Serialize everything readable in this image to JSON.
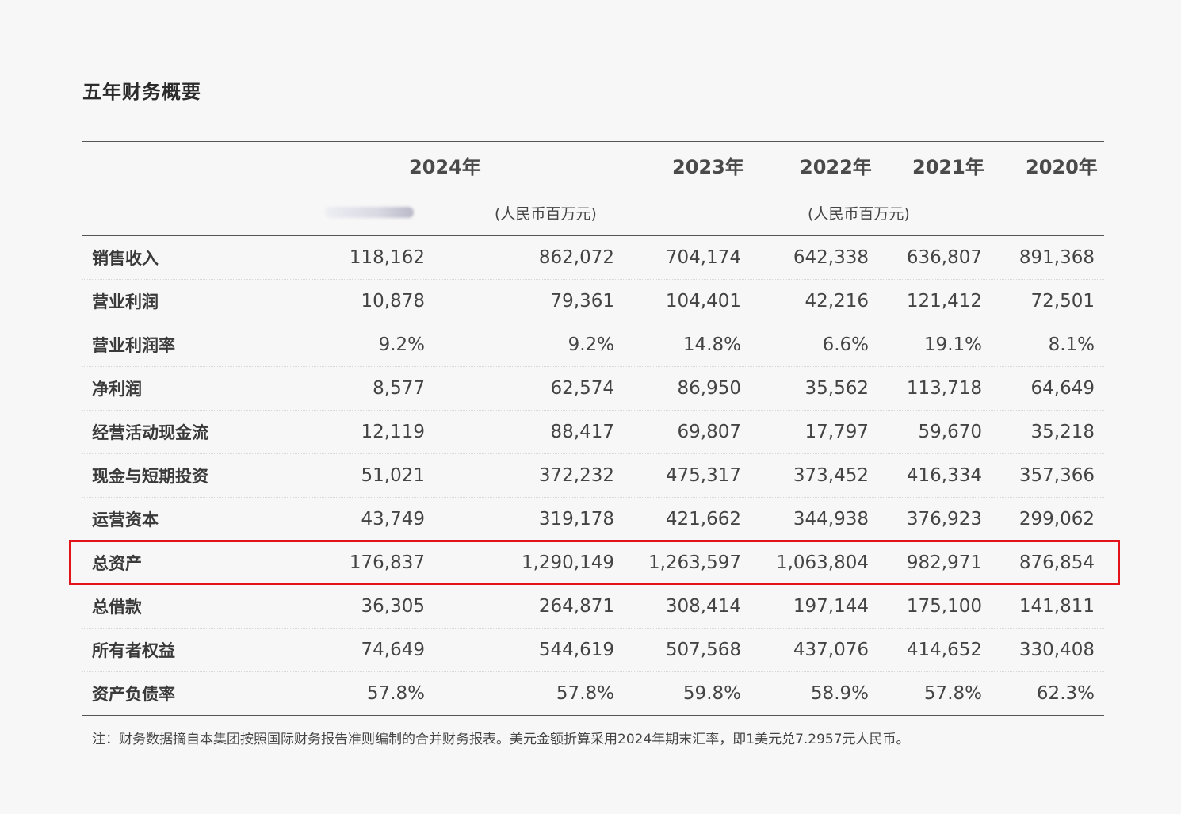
{
  "page_title": "五年财务概要",
  "years": [
    "2024年",
    "2023年",
    "2022年",
    "2021年",
    "2020年"
  ],
  "units": {
    "blurred_label": "",
    "rmb_2024": "(人民币百万元)",
    "rmb_prior": "(人民币百万元)"
  },
  "rows": [
    {
      "label": "销售收入",
      "values": [
        "118,162",
        "862,072",
        "704,174",
        "642,338",
        "636,807",
        "891,368"
      ]
    },
    {
      "label": "营业利润",
      "values": [
        "10,878",
        "79,361",
        "104,401",
        "42,216",
        "121,412",
        "72,501"
      ]
    },
    {
      "label": "营业利润率",
      "values": [
        "9.2%",
        "9.2%",
        "14.8%",
        "6.6%",
        "19.1%",
        "8.1%"
      ]
    },
    {
      "label": "净利润",
      "values": [
        "8,577",
        "62,574",
        "86,950",
        "35,562",
        "113,718",
        "64,649"
      ]
    },
    {
      "label": "经营活动现金流",
      "values": [
        "12,119",
        "88,417",
        "69,807",
        "17,797",
        "59,670",
        "35,218"
      ]
    },
    {
      "label": "现金与短期投资",
      "values": [
        "51,021",
        "372,232",
        "475,317",
        "373,452",
        "416,334",
        "357,366"
      ]
    },
    {
      "label": "运营资本",
      "values": [
        "43,749",
        "319,178",
        "421,662",
        "344,938",
        "376,923",
        "299,062"
      ]
    },
    {
      "label": "总资产",
      "values": [
        "176,837",
        "1,290,149",
        "1,263,597",
        "1,063,804",
        "982,971",
        "876,854"
      ],
      "highlighted": true
    },
    {
      "label": "总借款",
      "values": [
        "36,305",
        "264,871",
        "308,414",
        "197,144",
        "175,100",
        "141,811"
      ]
    },
    {
      "label": "所有者权益",
      "values": [
        "74,649",
        "544,619",
        "507,568",
        "437,076",
        "414,652",
        "330,408"
      ]
    },
    {
      "label": "资产负债率",
      "values": [
        "57.8%",
        "57.8%",
        "59.8%",
        "58.9%",
        "57.8%",
        "62.3%"
      ]
    }
  ],
  "note": "注：财务数据摘自本集团按照国际财务报告准则编制的合并财务报表。美元金额折算采用2024年期末汇率，即1美元兑7.2957元人民币。",
  "colors": {
    "highlight_border": "#e2141a",
    "background": "#f7f7f7",
    "rule": "#555555"
  }
}
